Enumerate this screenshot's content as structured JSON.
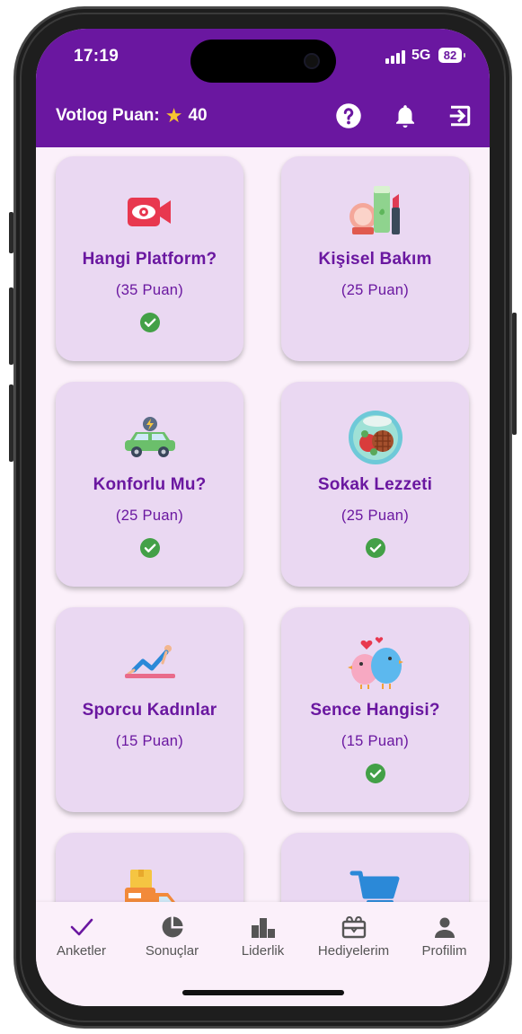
{
  "status": {
    "time": "17:19",
    "network": "5G",
    "battery": "82"
  },
  "header": {
    "label": "Votlog Puan:",
    "points": "40",
    "icons": [
      "help-icon",
      "bell-icon",
      "logout-icon"
    ]
  },
  "cards": [
    {
      "name": "Hangi Platform?",
      "points": "(35 Puan)",
      "icon": "video-eye-icon",
      "done": true
    },
    {
      "name": "Kişisel Bakım",
      "points": "(25 Puan)",
      "icon": "cosmetics-icon",
      "done": false
    },
    {
      "name": "Konforlu Mu?",
      "points": "(25 Puan)",
      "icon": "electric-car-icon",
      "done": true
    },
    {
      "name": "Sokak Lezzeti",
      "points": "(25 Puan)",
      "icon": "street-food-icon",
      "done": true
    },
    {
      "name": "Sporcu Kadınlar",
      "points": "(15 Puan)",
      "icon": "workout-icon",
      "done": false
    },
    {
      "name": "Sence Hangisi?",
      "points": "(15 Puan)",
      "icon": "love-birds-icon",
      "done": true
    },
    {
      "name": "",
      "points": "",
      "icon": "delivery-truck-icon",
      "done": false
    },
    {
      "name": "",
      "points": "",
      "icon": "shopping-cart-icon",
      "done": false
    }
  ],
  "nav": [
    {
      "label": "Anketler",
      "icon": "check-icon"
    },
    {
      "label": "Sonuçlar",
      "icon": "pie-chart-icon"
    },
    {
      "label": "Liderlik",
      "icon": "leaderboard-icon"
    },
    {
      "label": "Hediyelerim",
      "icon": "gift-icon"
    },
    {
      "label": "Profilim",
      "icon": "person-icon"
    }
  ],
  "colors": {
    "primary": "#6a17a0",
    "card": "#ead8f2",
    "background": "#fbf0fa",
    "check": "#43a047",
    "star": "#f7c531"
  }
}
